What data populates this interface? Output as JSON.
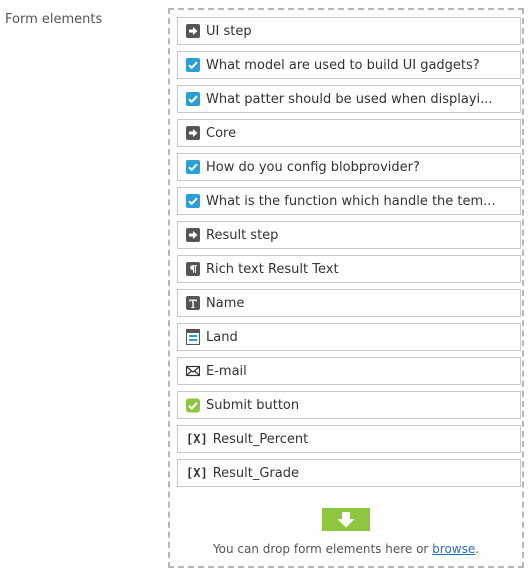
{
  "field": {
    "label": "Form elements"
  },
  "form_elements": [
    {
      "label": "UI step",
      "icon": "step-arrow-icon"
    },
    {
      "label": "What model are used to build UI gadgets?",
      "icon": "checkbox-icon"
    },
    {
      "label": "What patter should be used when displayi...",
      "icon": "checkbox-icon"
    },
    {
      "label": "Core",
      "icon": "step-arrow-icon"
    },
    {
      "label": "How do you config blobprovider?",
      "icon": "checkbox-icon"
    },
    {
      "label": "What is the function which handle the tem...",
      "icon": "checkbox-icon"
    },
    {
      "label": "Result step",
      "icon": "step-arrow-icon"
    },
    {
      "label": "Rich text Result Text",
      "icon": "paragraph-icon"
    },
    {
      "label": "Name",
      "icon": "text-field-icon"
    },
    {
      "label": "Land",
      "icon": "select-list-icon"
    },
    {
      "label": "E-mail",
      "icon": "envelope-icon"
    },
    {
      "label": "Submit button",
      "icon": "submit-check-icon"
    },
    {
      "label": "Result_Percent",
      "icon": "variable-icon"
    },
    {
      "label": "Result_Grade",
      "icon": "variable-icon"
    }
  ],
  "icon_text": {
    "variable": "[X]"
  },
  "drop_zone": {
    "icon": "drop-arrow-icon",
    "text": "You can drop form elements here or",
    "link": "browse",
    "suffix": "."
  },
  "colors": {
    "checkbox": "#2a9fd6",
    "drop_arrow": "#8dc63f",
    "submit_check": "#8dc63f",
    "link": "#2a6ebb",
    "step_icon": "#555555"
  }
}
